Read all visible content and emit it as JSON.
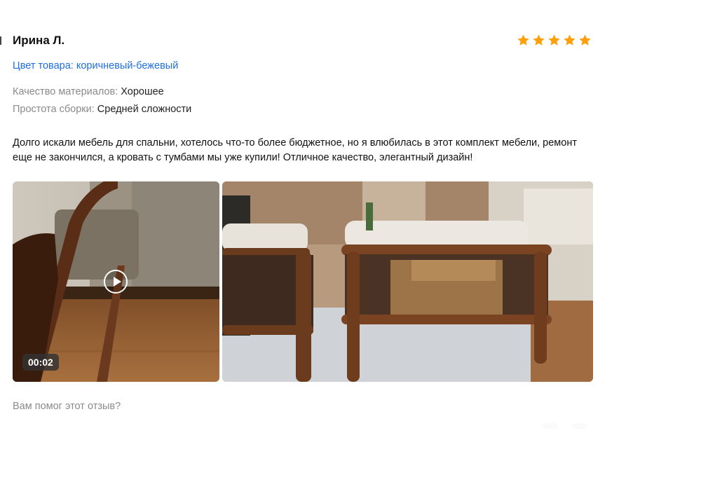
{
  "review": {
    "author": "Ирина Л.",
    "rating": 5,
    "rating_max": 5,
    "color_line": "Цвет товара: коричневый-бежевый",
    "attributes": [
      {
        "key": "Качество материалов:",
        "value": "Хорошее"
      },
      {
        "key": "Простота сборки:",
        "value": "Средней сложности"
      }
    ],
    "text": "Долго искали мебель для спальни, хотелось что-то более бюджетное, но я влюбилась в этот комплект мебели, ремонт еще не закончился, а кровать с тумбами мы уже купили! Отличное качество, элегантный дизайн!",
    "media": [
      {
        "kind": "video",
        "duration": "00:02"
      },
      {
        "kind": "photo"
      }
    ],
    "helpful_question": "Вам помог этот отзыв?"
  },
  "colors": {
    "star": "#ff9f0a",
    "link": "#1f6fe0",
    "muted": "#8a8a8a"
  }
}
